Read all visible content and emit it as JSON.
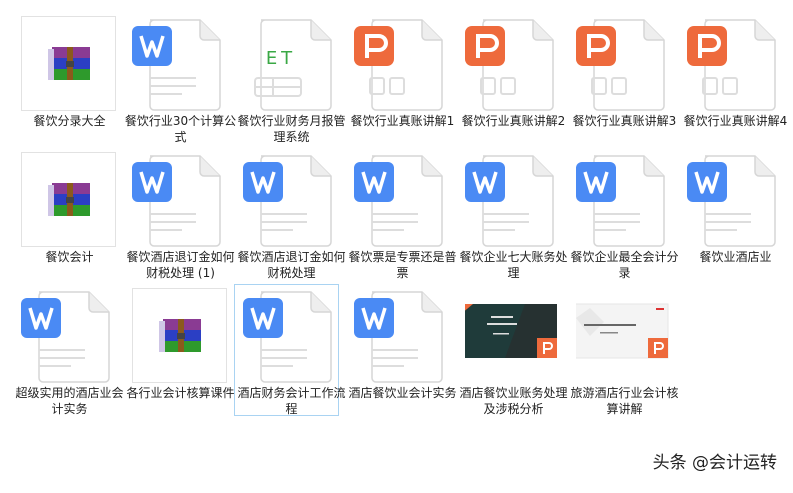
{
  "files": [
    {
      "name": "餐饮分录大全",
      "type": "rar"
    },
    {
      "name": "餐饮行业30个计算公式",
      "type": "word"
    },
    {
      "name": "餐饮行业财务月报管理系统",
      "type": "et"
    },
    {
      "name": "餐饮行业真账讲解1",
      "type": "ppt"
    },
    {
      "name": "餐饮行业真账讲解2",
      "type": "ppt"
    },
    {
      "name": "餐饮行业真账讲解3",
      "type": "ppt"
    },
    {
      "name": "餐饮行业真账讲解4",
      "type": "ppt"
    },
    {
      "name": "餐饮会计",
      "type": "rar"
    },
    {
      "name": "餐饮酒店退订金如何财税处理 (1)",
      "type": "word"
    },
    {
      "name": "餐饮酒店退订金如何财税处理",
      "type": "word"
    },
    {
      "name": "餐饮票是专票还是普票",
      "type": "word"
    },
    {
      "name": "餐饮企业七大账务处理",
      "type": "word"
    },
    {
      "name": "餐饮企业最全会计分录",
      "type": "word"
    },
    {
      "name": "餐饮业酒店业",
      "type": "word"
    },
    {
      "name": "超级实用的酒店业会计实务",
      "type": "word"
    },
    {
      "name": "各行业会计核算课件",
      "type": "rar"
    },
    {
      "name": "酒店财务会计工作流程",
      "type": "word",
      "selected": true
    },
    {
      "name": "酒店餐饮业会计实务",
      "type": "word"
    },
    {
      "name": "酒店餐饮业账务处理及涉税分析",
      "type": "ppt-dark"
    },
    {
      "name": "旅游酒店行业会计核算讲解",
      "type": "ppt-light"
    }
  ],
  "et_label": "ET",
  "watermark": "头条 @会计运转",
  "colors": {
    "word": "#4a8af4",
    "ppt": "#ee6a3c",
    "et": "#3aa845",
    "select": "#a9d3f2"
  }
}
